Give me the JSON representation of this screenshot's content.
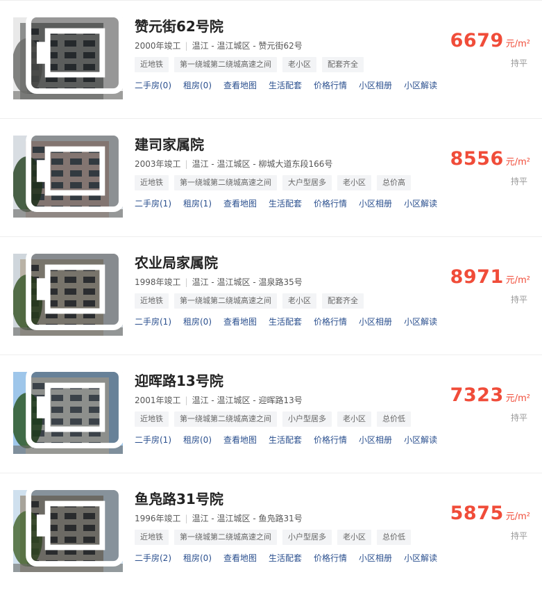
{
  "listings": [
    {
      "name": "赞元街62号院",
      "year": "2000年竣工",
      "location": "温江 - 温江城区 - 赞元街62号",
      "tags": [
        "近地铁",
        "第一绕城第二绕城高速之间",
        "老小区",
        "配套齐全"
      ],
      "links": [
        "二手房(0)",
        "租房(0)",
        "查看地图",
        "生活配套",
        "价格行情",
        "小区相册",
        "小区解读"
      ],
      "price": "6679",
      "unit": "元/m²",
      "holding": "持平"
    },
    {
      "name": "建司家属院",
      "year": "2003年竣工",
      "location": "温江 - 温江城区 - 柳城大道东段166号",
      "tags": [
        "近地铁",
        "第一绕城第二绕城高速之间",
        "大户型居多",
        "老小区",
        "总价高"
      ],
      "links": [
        "二手房(1)",
        "租房(1)",
        "查看地图",
        "生活配套",
        "价格行情",
        "小区相册",
        "小区解读"
      ],
      "price": "8556",
      "unit": "元/m²",
      "holding": "持平"
    },
    {
      "name": "农业局家属院",
      "year": "1998年竣工",
      "location": "温江 - 温江城区 - 温泉路35号",
      "tags": [
        "近地铁",
        "第一绕城第二绕城高速之间",
        "老小区",
        "配套齐全"
      ],
      "links": [
        "二手房(1)",
        "租房(0)",
        "查看地图",
        "生活配套",
        "价格行情",
        "小区相册",
        "小区解读"
      ],
      "price": "8971",
      "unit": "元/m²",
      "holding": "持平"
    },
    {
      "name": "迎晖路13号院",
      "year": "2001年竣工",
      "location": "温江 - 温江城区 - 迎晖路13号",
      "tags": [
        "近地铁",
        "第一绕城第二绕城高速之间",
        "小户型居多",
        "老小区",
        "总价低"
      ],
      "links": [
        "二手房(1)",
        "租房(0)",
        "查看地图",
        "生活配套",
        "价格行情",
        "小区相册",
        "小区解读"
      ],
      "price": "7323",
      "unit": "元/m²",
      "holding": "持平"
    },
    {
      "name": "鱼凫路31号院",
      "year": "1996年竣工",
      "location": "温江 - 温江城区 - 鱼凫路31号",
      "tags": [
        "近地铁",
        "第一绕城第二绕城高速之间",
        "小户型居多",
        "老小区",
        "总价低"
      ],
      "links": [
        "二手房(2)",
        "租房(0)",
        "查看地图",
        "生活配套",
        "价格行情",
        "小区相册",
        "小区解读"
      ],
      "price": "5875",
      "unit": "元/m²",
      "holding": "持平"
    }
  ],
  "icons": {
    "photo": "photo-album-icon"
  },
  "colors": {
    "price": "#f04c39",
    "link": "#2a4f8e",
    "tag_bg": "#f3f4f6"
  }
}
